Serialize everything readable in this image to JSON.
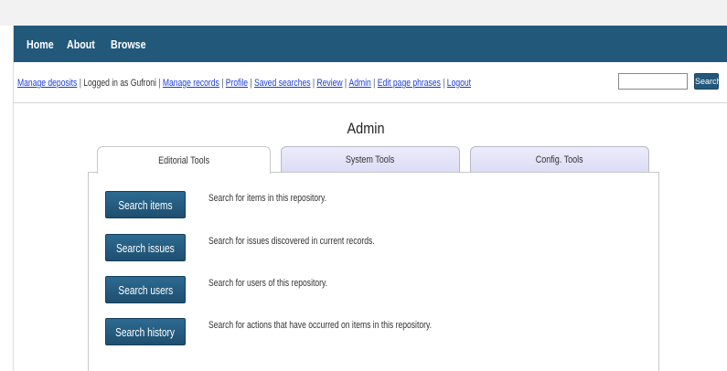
{
  "nav": {
    "items": [
      "Home",
      "About",
      "Browse"
    ]
  },
  "userbar": {
    "manage_deposits": "Manage deposits",
    "logged_in_text": "Logged in as Gufroni",
    "links": [
      "Manage records",
      "Profile",
      "Saved searches",
      "Review",
      "Admin",
      "Edit page phrases",
      "Logout"
    ],
    "search_value": "",
    "search_button": "Search"
  },
  "main": {
    "title": "Admin",
    "tabs": [
      {
        "label": "Editorial Tools",
        "active": true
      },
      {
        "label": "System Tools",
        "active": false
      },
      {
        "label": "Config. Tools",
        "active": false
      }
    ],
    "tools": [
      {
        "button": "Search items",
        "description": "Search for items in this repository."
      },
      {
        "button": "Search issues",
        "description": "Search for issues discovered in current records."
      },
      {
        "button": "Search users",
        "description": "Search for users of this repository."
      },
      {
        "button": "Search history",
        "description": "Search for actions that have occurred on items in this repository."
      }
    ]
  },
  "colors": {
    "navbar": "#22587a",
    "link": "#1a3dd6",
    "tab_inactive": "#dcdcf6",
    "button": "#22587a"
  }
}
